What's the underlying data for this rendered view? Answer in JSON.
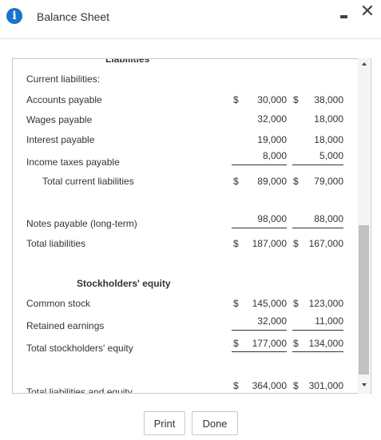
{
  "window": {
    "title": "Balance Sheet",
    "info_icon_glyph": "i",
    "minimize_icon": "minimize-icon",
    "close_glyph": "✕"
  },
  "sheet": {
    "cut_top_heading": "Liabilities",
    "current_liabilities_heading": "Current liabilities:",
    "rows": {
      "accounts_payable": {
        "label": "Accounts payable",
        "c1_dollar": "$",
        "c1": "30,000",
        "c2_dollar": "$",
        "c2": "38,000"
      },
      "wages_payable": {
        "label": "Wages payable",
        "c1": "32,000",
        "c2": "18,000"
      },
      "interest_payable": {
        "label": "Interest payable",
        "c1": "19,000",
        "c2": "18,000"
      },
      "income_taxes_payable": {
        "label": "Income taxes payable",
        "c1": "8,000",
        "c2": "5,000"
      },
      "total_current_liabilities": {
        "label": "Total current liabilities",
        "c1_dollar": "$",
        "c1": "89,000",
        "c2_dollar": "$",
        "c2": "79,000"
      },
      "notes_payable": {
        "label": "Notes payable (long-term)",
        "c1": "98,000",
        "c2": "88,000"
      },
      "total_liabilities": {
        "label": "Total liabilities",
        "c1_dollar": "$",
        "c1": "187,000",
        "c2_dollar": "$",
        "c2": "167,000"
      },
      "common_stock": {
        "label": "Common stock",
        "c1_dollar": "$",
        "c1": "145,000",
        "c2_dollar": "$",
        "c2": "123,000"
      },
      "retained_earnings": {
        "label": "Retained earnings",
        "c1": "32,000",
        "c2": "11,000"
      },
      "total_stockholders_equity": {
        "label": "Total stockholders' equity",
        "c1_dollar": "$",
        "c1": "177,000",
        "c2_dollar": "$",
        "c2": "134,000"
      },
      "total_liabilities_equity": {
        "label": "Total liabilities and equity",
        "c1_dollar": "$",
        "c1": "364,000",
        "c2_dollar": "$",
        "c2": "301,000"
      }
    },
    "stockholders_equity_heading": "Stockholders' equity"
  },
  "buttons": {
    "print": "Print",
    "done": "Done"
  }
}
